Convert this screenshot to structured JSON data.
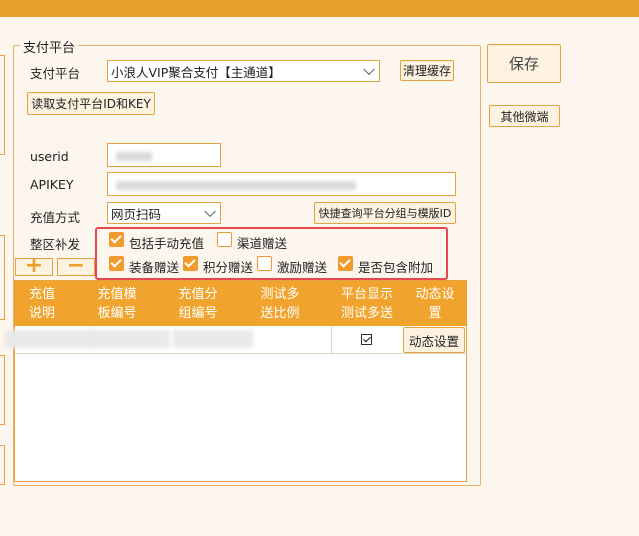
{
  "group": {
    "title": "支付平台"
  },
  "platform": {
    "label": "支付平台",
    "selected": "小浪人VIP聚合支付【主通道】"
  },
  "buttons": {
    "clear_cache": "清理缓存",
    "read_platform": "读取支付平台ID和KEY",
    "save": "保存",
    "other_wechat": "其他微端",
    "quick_query": "快捷查询平台分组与模版ID",
    "dynamic_settings": "动态设置"
  },
  "fields": {
    "userid_label": "userid",
    "apikey_label": "APIKEY",
    "recharge_label": "充值方式",
    "recharge_value": "网页扫码",
    "bonus_label": "整区补发"
  },
  "options": [
    {
      "label": "包括手动充值",
      "checked": true
    },
    {
      "label": "渠道赠送",
      "checked": false
    },
    {
      "label": "装备赠送",
      "checked": true
    },
    {
      "label": "积分赠送",
      "checked": true
    },
    {
      "label": "激励赠送",
      "checked": false
    },
    {
      "label": "是否包含附加",
      "checked": true
    }
  ],
  "toolbar": {
    "add": "+",
    "remove": "−"
  },
  "table": {
    "headers": [
      [
        "充值",
        "说明"
      ],
      [
        "充值模",
        "板编号"
      ],
      [
        "充值分",
        "组编号"
      ],
      [
        "测试多",
        "送比例"
      ],
      [
        "平台显示",
        "测试多送"
      ],
      [
        "动态设",
        "置"
      ]
    ],
    "rows": [
      {
        "show_test": true,
        "action": "动态设置"
      }
    ]
  },
  "colors": {
    "accent": "#e8a02f",
    "header": "#f0a42e",
    "highlight": "#e5484d"
  }
}
